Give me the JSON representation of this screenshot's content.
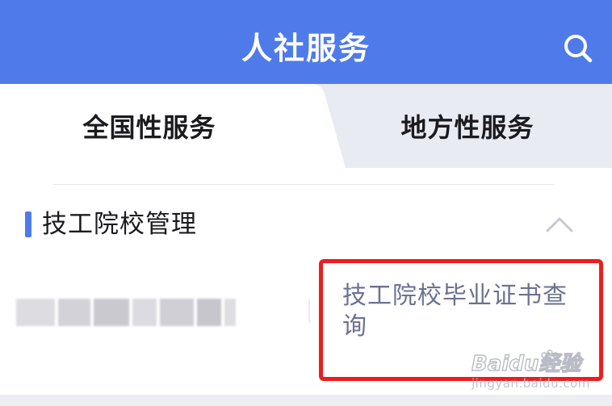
{
  "header": {
    "title": "人社服务",
    "background": "#4f7bea",
    "search_icon": "search-icon"
  },
  "tabs": [
    {
      "label": "全国性服务",
      "active": true
    },
    {
      "label": "地方性服务",
      "active": false
    }
  ],
  "section": {
    "title": "技工院校管理",
    "accent": "#4f7bea",
    "collapse_icon": "chevron-up-icon"
  },
  "items": [
    {
      "label": "",
      "blurred": true
    },
    {
      "label": "技工院校毕业证书查询",
      "highlighted": true,
      "highlight_color": "#ee1d1d"
    }
  ],
  "watermark": {
    "logo": "Baidu经验",
    "url": "jingyan.baidu.com"
  }
}
